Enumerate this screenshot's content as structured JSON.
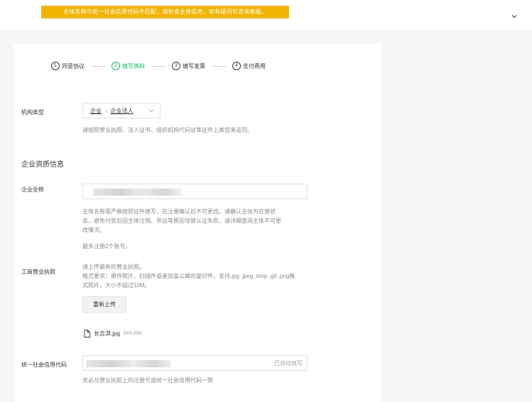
{
  "alert": {
    "text": "主体名称与统一社会信用代码不匹配，请检查主体信息，如有疑问可咨询客服。"
  },
  "header": {
    "dropdown_icon": "chevron-down-icon"
  },
  "steps": [
    {
      "num": "1",
      "label": "同意协议"
    },
    {
      "num": "2",
      "label": "填写资料"
    },
    {
      "num": "3",
      "label": "填写发票"
    },
    {
      "num": "4",
      "label": "支付费用"
    }
  ],
  "form": {
    "org_type": {
      "label": "机构类型",
      "value_level1": "企业",
      "value_level2": "企业法人",
      "hint": "请按照营业执照、法人证书、组织机构代码证等证件上类型来返回。"
    },
    "section_title": "企业资质信息",
    "company_name": {
      "label": "企业全称",
      "hint_line1": "主体名称需严格按照证件填写，在注册确认后不可更改。请确认主体为在营状",
      "hint_line2": "态，避免付款后因主体注销、吊出等原因导致认证失败，请详细查阅主体不可更",
      "hint_line3": "改情况。",
      "limit": "最多注册2个账号。"
    },
    "license": {
      "label": "工商营业执照",
      "hint_line1": "请上传最新的营业执照。",
      "hint_line2": "格式要求：原件照片、扫描件或者加盖公章的复印件，支持.jpg .jpeg .bmp .gif .png格",
      "hint_line3": "式照片，大小不超过10M。",
      "reupload_button": "重新上传",
      "file_name": "长吉淇.jpg",
      "file_size": "664.69K"
    },
    "credit_code": {
      "label": "统一社会信用代码",
      "autofill": "已自动填写",
      "hint": "务必与营业执照上的注册号或统一社会信用代码一致"
    }
  },
  "colors": {
    "alert_bg": "#f0b400",
    "active_step": "#07c160"
  }
}
